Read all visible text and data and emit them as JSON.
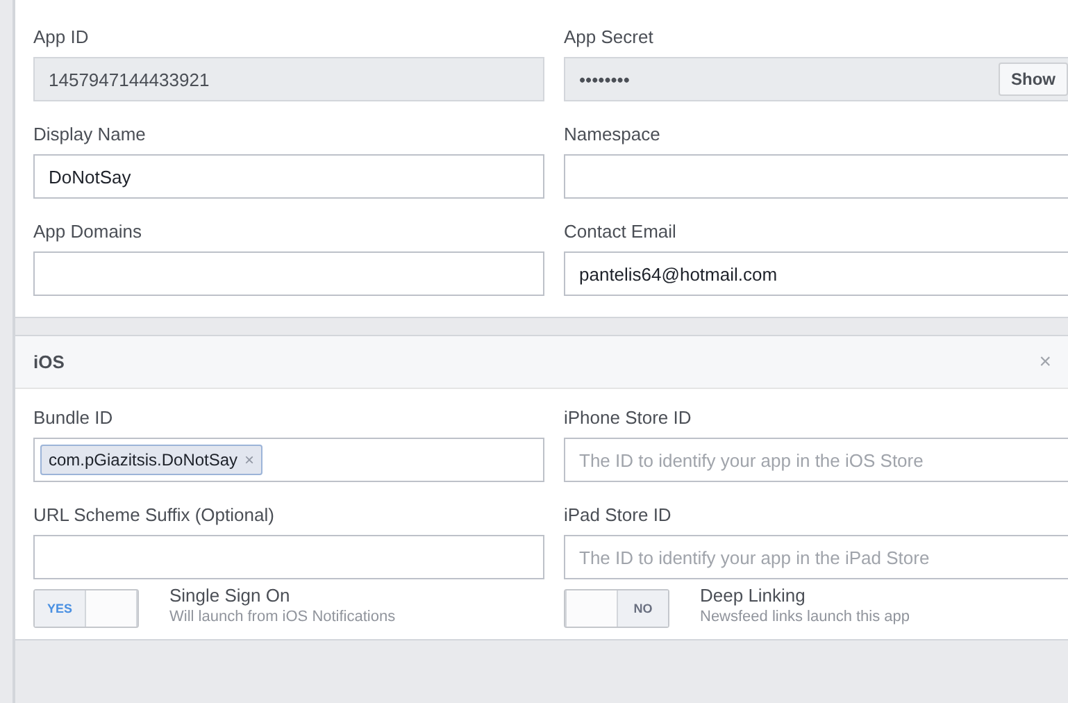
{
  "basic": {
    "fields": [
      {
        "label": "App ID",
        "value": "1457947144433921",
        "kind": "readonly"
      },
      {
        "label": "App Secret",
        "value": "••••••••",
        "kind": "secret",
        "button": "Show"
      },
      {
        "label": "Display Name",
        "value": "DoNotSay",
        "kind": "text"
      },
      {
        "label": "Namespace",
        "kind": "text"
      },
      {
        "label": "App Domains",
        "kind": "text"
      },
      {
        "label": "Contact Email",
        "value": "pantelis64@hotmail.com",
        "kind": "text"
      }
    ]
  },
  "ios": {
    "title": "iOS",
    "close": "×",
    "fields": [
      {
        "label": "Bundle ID",
        "kind": "tags",
        "tags": [
          {
            "text": "com.pGiazitsis.DoNotSay",
            "remove": "×"
          }
        ]
      },
      {
        "label": "iPhone Store ID",
        "kind": "text",
        "placeholder": "The ID to identify your app in the iOS Store"
      },
      {
        "label": "URL Scheme Suffix (Optional)",
        "kind": "text"
      },
      {
        "label": "iPad Store ID",
        "kind": "text",
        "placeholder": "The ID to identify your app in the iPad Store"
      }
    ],
    "toggles": [
      {
        "label": "Single Sign On",
        "description": "Will launch from iOS Notifications",
        "state_text": "YES",
        "on": true
      },
      {
        "label": "Deep Linking",
        "description": "Newsfeed links launch this app",
        "state_text": "NO",
        "on": false
      }
    ]
  }
}
